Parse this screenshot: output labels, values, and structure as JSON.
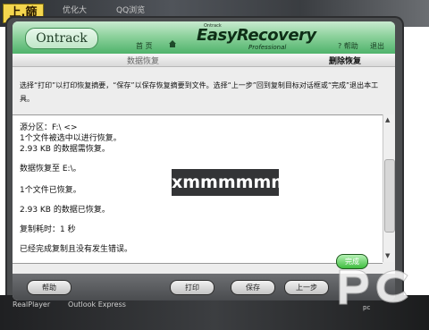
{
  "background": {
    "top_texts": [
      "优化大",
      "QQ浏览"
    ],
    "bottom_texts": [
      "RealPlayer",
      "Outlook Express"
    ],
    "corner_tag": "上.篩"
  },
  "header": {
    "brand": "Ontrack",
    "small_left": "首 页",
    "small_left_icon": "home-icon",
    "logo_caption": "Ontrack",
    "logo": "EasyRecovery",
    "logo_sub": "Professional",
    "help": "? 帮助",
    "exit": "退出"
  },
  "steps": {
    "left": "数据恢复",
    "right": "删除恢复"
  },
  "instruction": "选择“打印”以打印恢复摘要，“保存”以保存恢复摘要到文件。选择“上一步”回到复制目标对话框或“完成”退出本工具。",
  "log": {
    "lines": [
      "源分区：F:\\ <>",
      "1个文件被选中以进行恢复。",
      "2.93 KB 的数据需恢复。",
      "数据恢复至 E:\\。",
      "1个文件已恢复。",
      "2.93 KB 的数据已恢复。",
      "复制耗时：1 秒",
      "已经完成复制且没有发生错误。"
    ],
    "redaction": "xmmmmmmx"
  },
  "buttons": {
    "help": "帮助",
    "print": "打印",
    "save": "保存",
    "back": "上一步",
    "finish": "完成"
  },
  "watermark": "pc",
  "colors": {
    "header_green": "#4fb36b",
    "frame_dark": "#4b4d4f",
    "finish_green": "#3fbd3f"
  }
}
